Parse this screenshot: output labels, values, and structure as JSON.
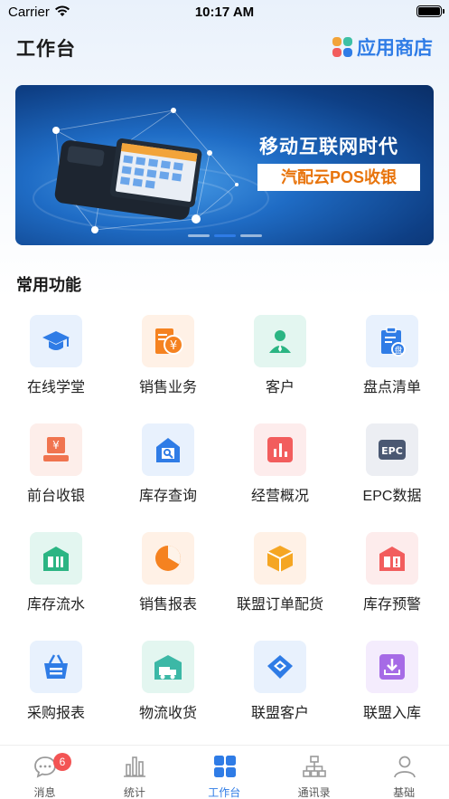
{
  "status_bar": {
    "carrier": "Carrier",
    "time": "10:17 AM"
  },
  "header": {
    "title": "工作台",
    "app_store_label": "应用商店"
  },
  "banner": {
    "headline": "移动互联网时代",
    "tag": "汽配云POS收银",
    "dots": 3,
    "active_dot": 1
  },
  "section": {
    "title": "常用功能"
  },
  "functions": [
    {
      "label": "在线学堂",
      "icon": "graduation-cap-icon",
      "bg": "#e8f1fd",
      "color": "#2f7ce6"
    },
    {
      "label": "销售业务",
      "icon": "sales-receipt-icon",
      "bg": "#fff1e6",
      "color": "#f58220"
    },
    {
      "label": "客户",
      "icon": "customer-person-icon",
      "bg": "#e3f6f0",
      "color": "#2bb583"
    },
    {
      "label": "盘点清单",
      "icon": "inventory-clipboard-icon",
      "bg": "#e8f1fd",
      "color": "#2f7ce6"
    },
    {
      "label": "前台收银",
      "icon": "cashier-register-icon",
      "bg": "#fdeeea",
      "color": "#f0744f"
    },
    {
      "label": "库存查询",
      "icon": "stock-search-icon",
      "bg": "#e8f1fd",
      "color": "#2f7ce6"
    },
    {
      "label": "经营概况",
      "icon": "business-chart-icon",
      "bg": "#fdecec",
      "color": "#f25d5d"
    },
    {
      "label": "EPC数据",
      "icon": "epc-data-icon",
      "bg": "#eceef3",
      "color": "#4a5872"
    },
    {
      "label": "库存流水",
      "icon": "stock-flow-icon",
      "bg": "#e3f6f0",
      "color": "#2bb583"
    },
    {
      "label": "销售报表",
      "icon": "sales-pie-icon",
      "bg": "#fff1e6",
      "color": "#f58220"
    },
    {
      "label": "联盟订单配货",
      "icon": "alliance-box-icon",
      "bg": "#fff1e6",
      "color": "#f5a623"
    },
    {
      "label": "库存预警",
      "icon": "stock-alert-icon",
      "bg": "#fdecec",
      "color": "#f25d5d"
    },
    {
      "label": "采购报表",
      "icon": "purchase-basket-icon",
      "bg": "#e8f1fd",
      "color": "#2f7ce6"
    },
    {
      "label": "物流收货",
      "icon": "logistics-truck-icon",
      "bg": "#e3f6f0",
      "color": "#3cb8a6"
    },
    {
      "label": "联盟客户",
      "icon": "alliance-customer-icon",
      "bg": "#e8f1fd",
      "color": "#2f7ce6"
    },
    {
      "label": "联盟入库",
      "icon": "alliance-inbound-icon",
      "bg": "#f4ecfd",
      "color": "#a66be6"
    }
  ],
  "tab_bar": {
    "tabs": [
      {
        "label": "消息",
        "icon": "message-bubble-icon",
        "badge": "6"
      },
      {
        "label": "统计",
        "icon": "bar-stats-icon"
      },
      {
        "label": "工作台",
        "icon": "workbench-grid-icon",
        "active": true
      },
      {
        "label": "通讯录",
        "icon": "org-contacts-icon"
      },
      {
        "label": "基础",
        "icon": "user-profile-icon"
      }
    ]
  },
  "colors": {
    "accent": "#2f7ce6",
    "badge": "#f35454"
  }
}
